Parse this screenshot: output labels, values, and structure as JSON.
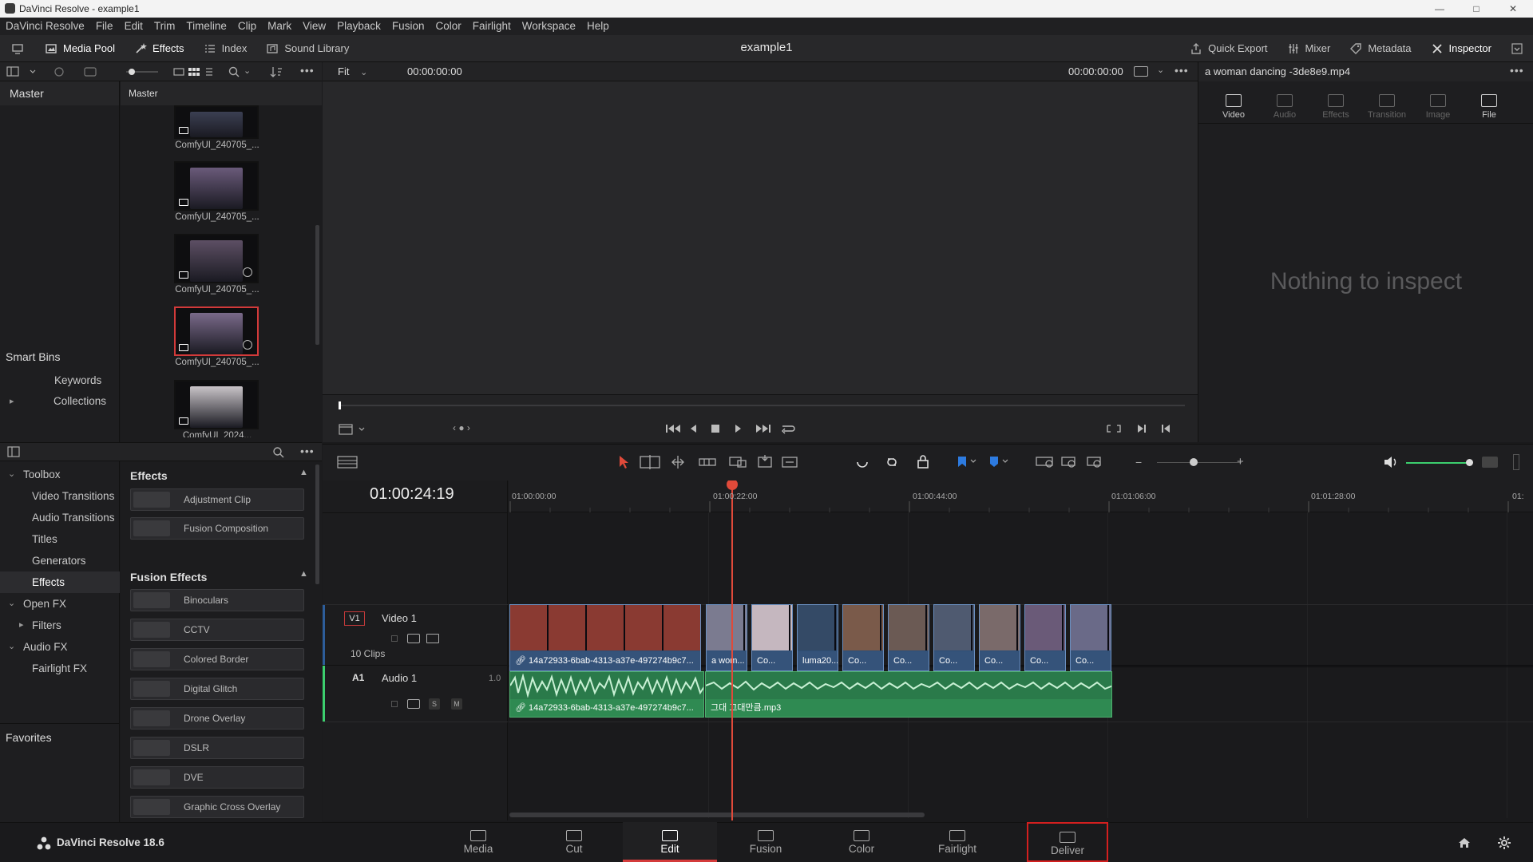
{
  "window": {
    "title": "DaVinci Resolve - example1"
  },
  "menu": [
    "DaVinci Resolve",
    "File",
    "Edit",
    "Trim",
    "Timeline",
    "Clip",
    "Mark",
    "View",
    "Playback",
    "Fusion",
    "Color",
    "Fairlight",
    "Workspace",
    "Help"
  ],
  "toolbar": {
    "media_pool": "Media Pool",
    "effects": "Effects",
    "index": "Index",
    "sound_library": "Sound Library",
    "project_title": "example1",
    "quick_export": "Quick Export",
    "mixer": "Mixer",
    "metadata": "Metadata",
    "inspector": "Inspector"
  },
  "bins": {
    "master": "Master",
    "smart_bins": "Smart Bins",
    "keywords": "Keywords",
    "collections": "Collections"
  },
  "media_pool": {
    "header": "Master",
    "clips": [
      {
        "label": "ComfyUI_240705_...",
        "color": "#3b3f52"
      },
      {
        "label": "ComfyUI_240705_...",
        "color": "#6a5a7a"
      },
      {
        "label": "ComfyUI_240705_...",
        "color": "#5d4f64"
      },
      {
        "label": "ComfyUI_240705_...",
        "color": "#7a6a8a"
      },
      {
        "label": "ComfyUI_2024...",
        "color": "#c9c4c8"
      }
    ]
  },
  "effects_tree": {
    "toolbox": "Toolbox",
    "video_transitions": "Video Transitions",
    "audio_transitions": "Audio Transitions",
    "titles": "Titles",
    "generators": "Generators",
    "effects": "Effects",
    "open_fx": "Open FX",
    "filters": "Filters",
    "audio_fx": "Audio FX",
    "fairlight_fx": "Fairlight FX",
    "favorites": "Favorites"
  },
  "effects_list": {
    "section_effects": "Effects",
    "items_effects": [
      "Adjustment Clip",
      "Fusion Composition"
    ],
    "section_fusion": "Fusion Effects",
    "items_fusion": [
      "Binoculars",
      "CCTV",
      "Colored Border",
      "Digital Glitch",
      "Drone Overlay",
      "DSLR",
      "DVE",
      "Graphic Cross Overlay"
    ]
  },
  "viewer": {
    "zoom": "Fit",
    "timecode_left": "00:00:00:00",
    "timecode_right": "00:00:00:00"
  },
  "inspector": {
    "clip_name": "a woman dancing -3de8e9.mp4",
    "tabs": [
      "Video",
      "Audio",
      "Effects",
      "Transition",
      "Image",
      "File"
    ],
    "empty": "Nothing to inspect"
  },
  "timeline": {
    "timecode": "01:00:24:19",
    "ruler": [
      "01:00:00:00",
      "01:00:22:00",
      "01:00:44:00",
      "01:01:06:00",
      "01:01:28:00",
      "01:"
    ],
    "video_track": {
      "id": "V1",
      "name": "Video 1",
      "count": "10 Clips"
    },
    "audio_track": {
      "id": "A1",
      "name": "Audio 1",
      "level": "1.0",
      "solo": "S",
      "mute": "M"
    },
    "video_clips": [
      {
        "label": "14a72933-6bab-4313-a37e-497274b9c7...",
        "color": "#8a3a32"
      },
      {
        "label": "a wom...",
        "color": "#7b7b90"
      },
      {
        "label": "Co...",
        "color": "#c5b7bf"
      },
      {
        "label": "luma20...",
        "color": "#344a66"
      },
      {
        "label": "Co...",
        "color": "#7a5a4a"
      },
      {
        "label": "Co...",
        "color": "#6b5a54"
      },
      {
        "label": "Co...",
        "color": "#4f5a70"
      },
      {
        "label": "Co...",
        "color": "#7a6a6a"
      },
      {
        "label": "Co...",
        "color": "#6a5a78"
      },
      {
        "label": "Co...",
        "color": "#6a6a88"
      }
    ],
    "audio_clips": [
      {
        "label": "14a72933-6bab-4313-a37e-497274b9c7..."
      },
      {
        "label": "그대 그대만큼.mp3"
      }
    ]
  },
  "pages": [
    "Media",
    "Cut",
    "Edit",
    "Fusion",
    "Color",
    "Fairlight",
    "Deliver"
  ],
  "footer": {
    "product": "DaVinci Resolve 18.6"
  },
  "colors": {
    "accent": "#d43b3b",
    "video_clip": "#2c4d75",
    "audio_clip": "#2a7a4a",
    "playhead": "#e04a3a"
  }
}
